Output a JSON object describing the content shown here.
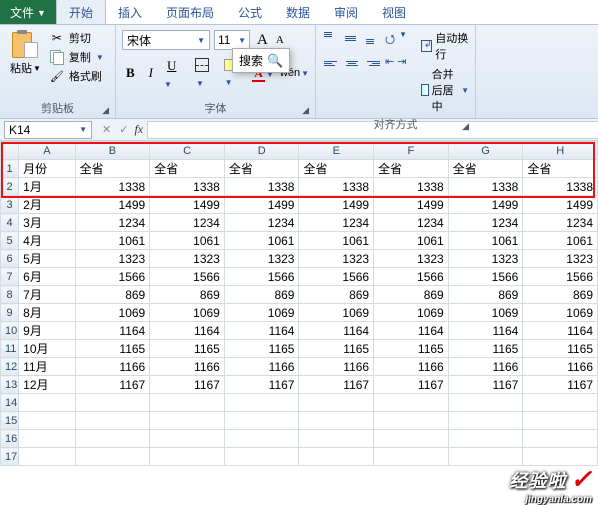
{
  "tabs": {
    "file": "文件",
    "home": "开始",
    "insert": "插入",
    "layout": "页面布局",
    "formula": "公式",
    "data": "数据",
    "review": "审阅",
    "view": "视图"
  },
  "clipboard": {
    "group": "剪贴板",
    "paste": "粘贴",
    "cut": "剪切",
    "copy": "复制",
    "painter": "格式刷"
  },
  "font": {
    "group": "字体",
    "name": "宋体",
    "size": "11",
    "bold": "B",
    "italic": "I",
    "underline": "U",
    "fontcolor": "A",
    "wen": "wén",
    "search": "搜索"
  },
  "align": {
    "group": "对齐方式",
    "wrap": "自动换行",
    "merge": "合并后居中"
  },
  "namebox": "K14",
  "fx": "fx",
  "cols": [
    "A",
    "B",
    "C",
    "D",
    "E",
    "F",
    "G",
    "H"
  ],
  "rows": [
    "1",
    "2",
    "3",
    "4",
    "5",
    "6",
    "7",
    "8",
    "9",
    "10",
    "11",
    "12",
    "13",
    "14",
    "15",
    "16",
    "17"
  ],
  "header_label": "全省",
  "month_col": "月份",
  "table_data": [
    {
      "m": "1月",
      "v": 1338
    },
    {
      "m": "2月",
      "v": 1499
    },
    {
      "m": "3月",
      "v": 1234
    },
    {
      "m": "4月",
      "v": 1061
    },
    {
      "m": "5月",
      "v": 1323
    },
    {
      "m": "6月",
      "v": 1566
    },
    {
      "m": "7月",
      "v": 869
    },
    {
      "m": "8月",
      "v": 1069
    },
    {
      "m": "9月",
      "v": 1164
    },
    {
      "m": "10月",
      "v": 1165
    },
    {
      "m": "11月",
      "v": 1166
    },
    {
      "m": "12月",
      "v": 1167
    }
  ],
  "watermark": {
    "text": "经验啦",
    "url": "jingyanla.com"
  }
}
